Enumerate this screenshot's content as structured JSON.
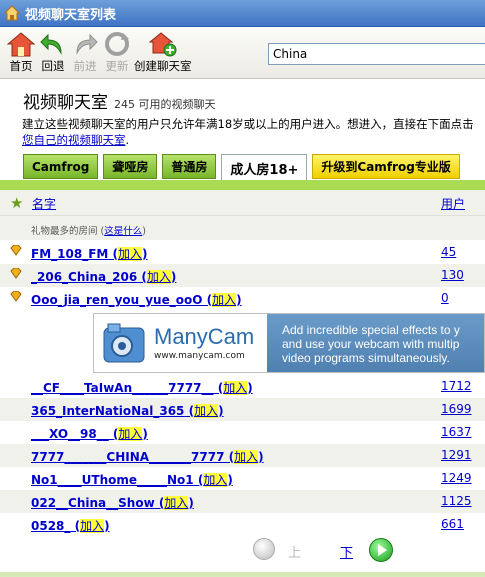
{
  "window": {
    "title": "视频聊天室列表"
  },
  "toolbar": {
    "home": "首页",
    "back": "回退",
    "forward": "前进",
    "refresh": "更新",
    "create": "创建聊天室",
    "search_value": "China"
  },
  "page": {
    "title": "视频聊天室",
    "count_text": "245 可用的视频聊天",
    "desc_line1": "建立这些视频聊天室的用户只允许年满18岁或以上的用户进入。想进入，直接在下面点击",
    "desc_link": "您自己的视频聊天室",
    "desc_end": "."
  },
  "tabs": [
    "Camfrog",
    "聋哑房",
    "普通房",
    "成人房18+",
    "升级到Camfrog专业版"
  ],
  "table": {
    "col_name": "名字",
    "col_users": "用户",
    "note_text": "礼物最多的房间 (",
    "note_link": "这是什么",
    "note_end": ")",
    "join_label": "加入",
    "gift_rows": [
      {
        "name": "FM_108_FM",
        "users": "45"
      },
      {
        "name": "_206_China_206",
        "users": "130"
      },
      {
        "name": "Ooo_jia_ren_you_yue_ooO",
        "users": "0"
      }
    ],
    "rows": [
      {
        "name": "__CF____TaIwAn______7777__",
        "users": "1712"
      },
      {
        "name": "365_InterNatioNal_365",
        "users": "1699"
      },
      {
        "name": "___XO__98__",
        "users": "1637"
      },
      {
        "name": "7777_______CHINA_______7777",
        "users": "1291"
      },
      {
        "name": "No1____UThome_____No1",
        "users": "1249"
      },
      {
        "name": "022__China__Show",
        "users": "1125"
      },
      {
        "name": "0528_",
        "users": "661"
      }
    ]
  },
  "banner": {
    "brand": "ManyCam",
    "url": "www.manycam.com",
    "ad_line1": "Add incredible special effects to y",
    "ad_line2": "and use your webcam with multip",
    "ad_line3": "video programs simultaneously."
  },
  "pager": {
    "prev": "上",
    "next": "下"
  },
  "colors": {
    "accent_green": "#a9dc52",
    "link": "#0000cc",
    "highlight": "#ffff3a"
  }
}
